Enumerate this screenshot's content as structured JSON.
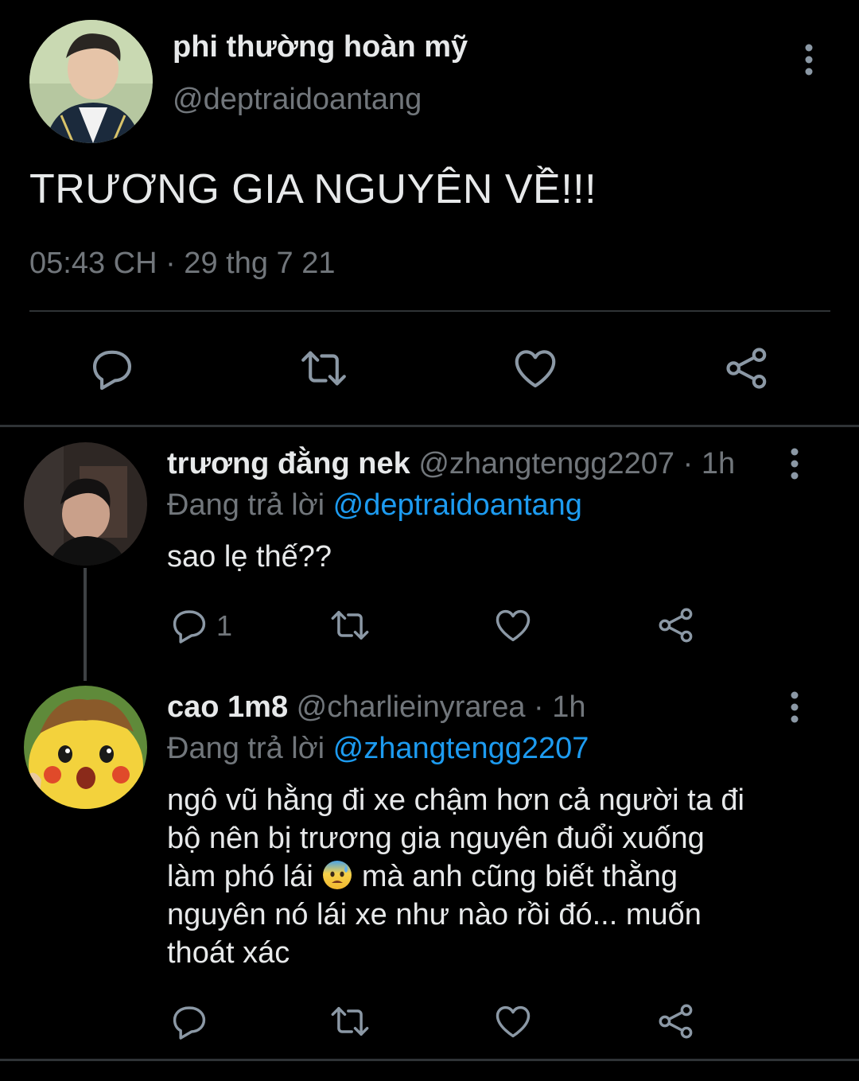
{
  "main_tweet": {
    "display_name": "phi thường hoàn mỹ",
    "handle": "@deptraidoantang",
    "text": "TRƯƠNG GIA NGUYÊN VỀ!!!",
    "timestamp": "05:43 CH · 29 thg 7 21",
    "actions": [
      "reply-icon",
      "retweet-icon",
      "like-icon",
      "share-icon"
    ]
  },
  "replies": [
    {
      "display_name": "trương đằng nek",
      "handle": "@zhangtengg2207",
      "age": "· 1h",
      "replying_prefix": "Đang trả lời ",
      "replying_to": "@deptraidoantang",
      "text": "sao lẹ thế??",
      "reply_count": "1"
    },
    {
      "display_name": "cao 1m8",
      "handle": "@charlieinyrarea",
      "age": "· 1h",
      "replying_prefix": "Đang trả lời ",
      "replying_to": "@zhangtengg2207",
      "text_lines": [
        "ngô vũ hằng đi xe chậm hơn cả người ta đi",
        "bộ nên bị trương gia nguyên đuổi xuống",
        "làm phó lái",
        " mà anh cũng biết thằng",
        "nguyên nó lái xe như nào rồi đó... muốn",
        "thoát xác"
      ],
      "emoji": "anxious-face-with-sweat-emoji"
    }
  ],
  "colors": {
    "background": "#000000",
    "text": "#e7e9ea",
    "secondary": "#71767b",
    "link": "#1d9bf0",
    "divider": "#2f3336"
  }
}
